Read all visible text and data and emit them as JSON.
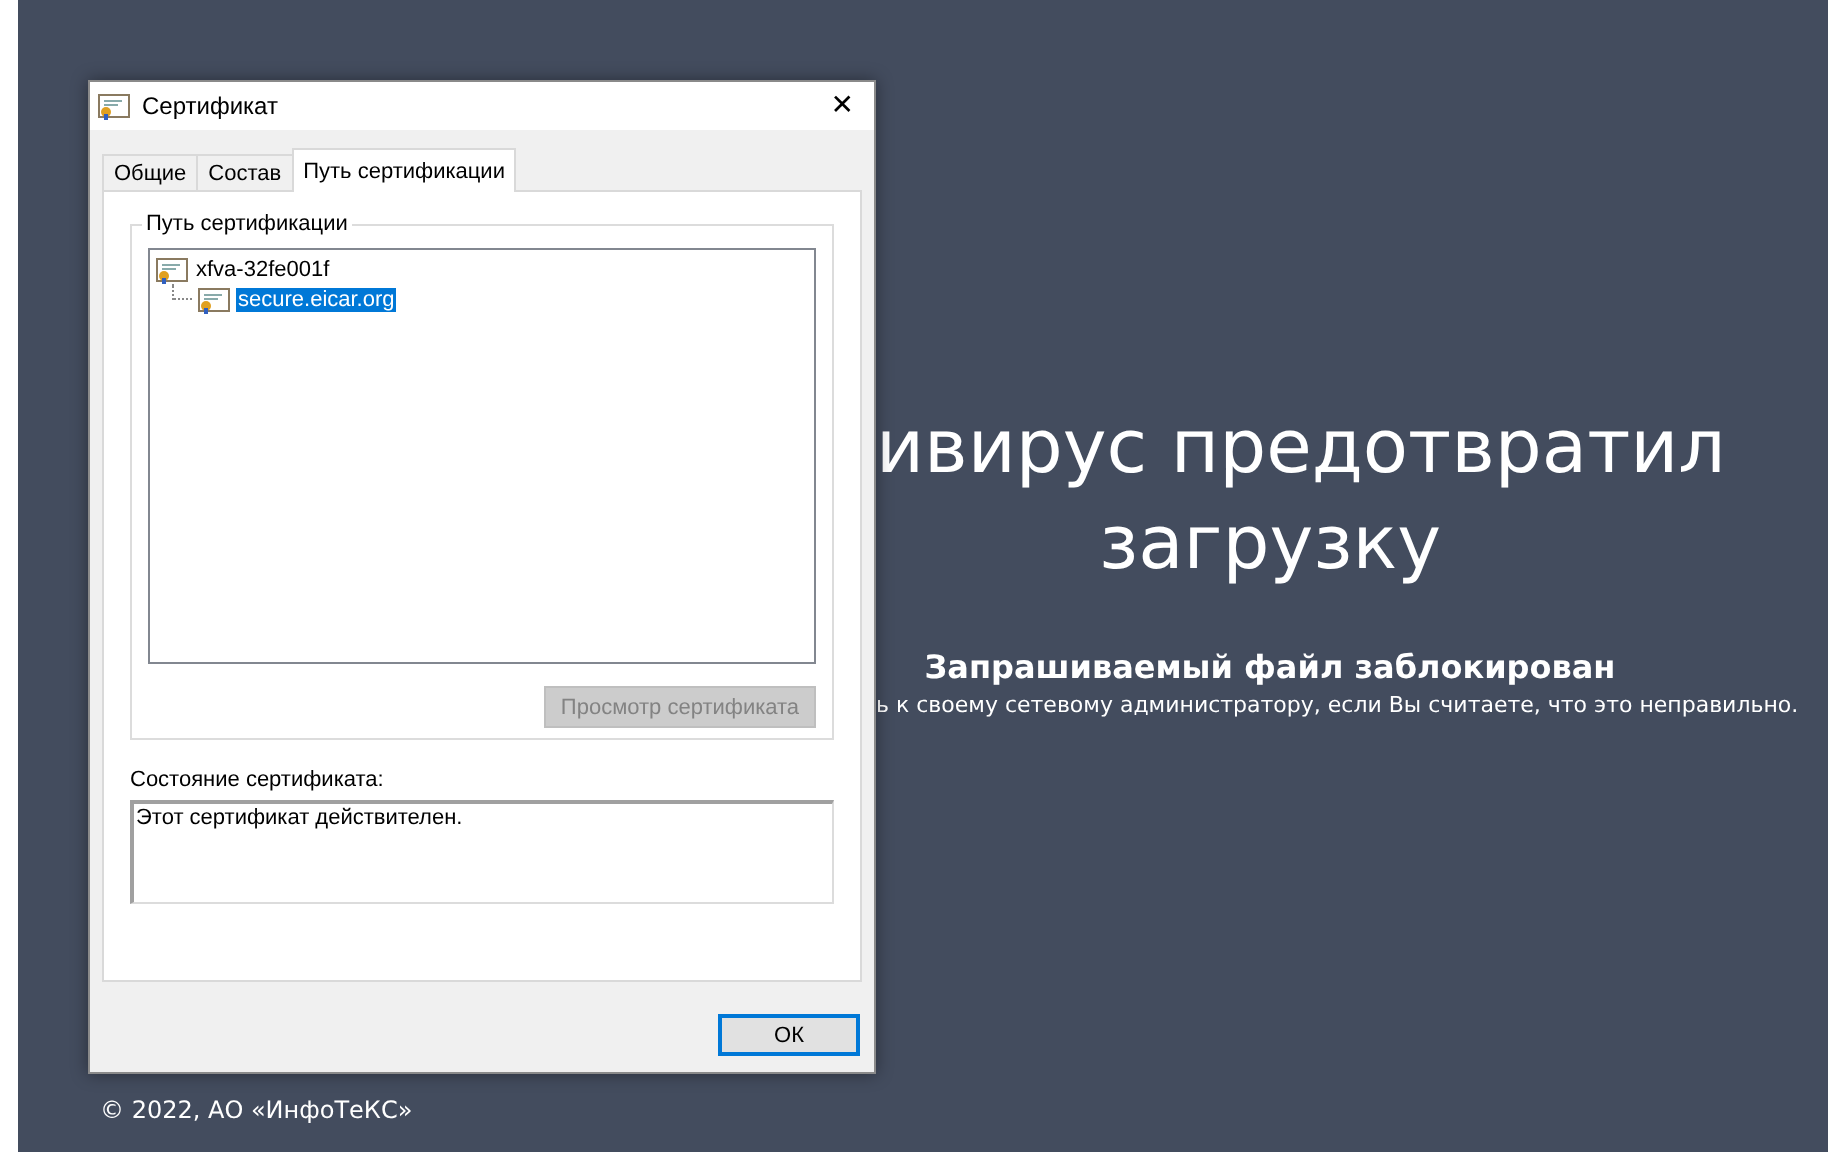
{
  "page": {
    "heading_lines": [
      "ивирус предотвратил",
      "загрузку"
    ],
    "subtitle": "Запрашиваемый файл заблокирован",
    "message": "ь к своему сетевому администратору, если Вы считаете, что это неправильно.",
    "footer": "© 2022, АО «ИнфоТеКС»"
  },
  "dialog": {
    "title": "Сертификат",
    "close": "✕",
    "tabs": [
      {
        "label": "Общие",
        "selected": false
      },
      {
        "label": "Состав",
        "selected": false
      },
      {
        "label": "Путь сертификации",
        "selected": true
      }
    ],
    "path_group": {
      "title": "Путь сертификации",
      "tree": [
        {
          "label": "xfva-32fe001f",
          "selected": false,
          "children": [
            {
              "label": "secure.eicar.org",
              "selected": true
            }
          ]
        }
      ],
      "view_button": {
        "label": "Просмотр сертификата",
        "disabled": true
      }
    },
    "status_label": "Состояние сертификата:",
    "status_text": "Этот сертификат действителен.",
    "ok_button": {
      "label": "ОК",
      "default": true
    }
  }
}
